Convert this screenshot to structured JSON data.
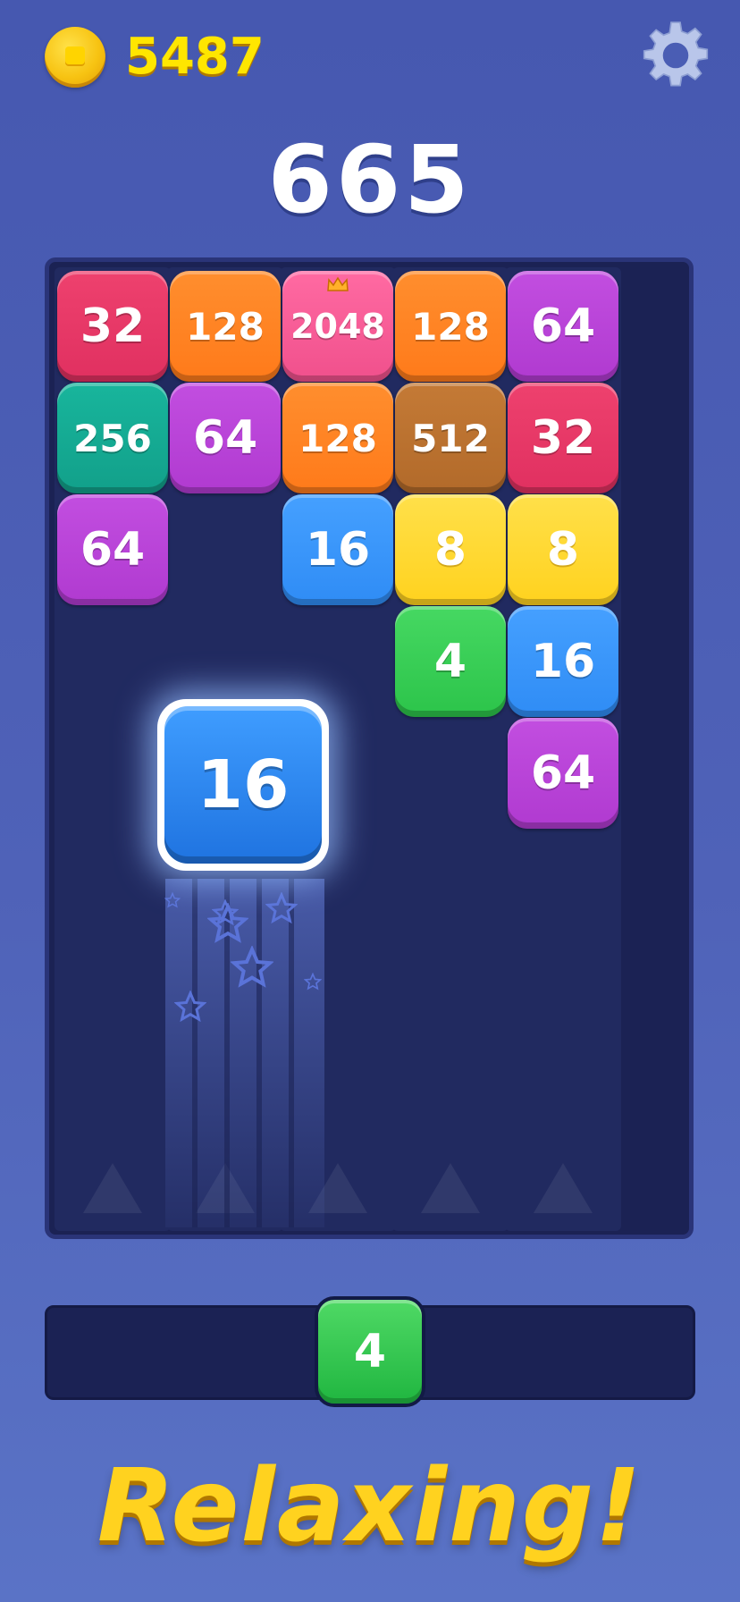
{
  "header": {
    "coins": "5487",
    "settings_icon": "gear-icon",
    "score": "665"
  },
  "colors": {
    "background": "#4f62b8",
    "board": "#1b2254",
    "tile_2048": "#f0508c",
    "tile_512": "#b26a2a",
    "tile_256": "#12a08a",
    "tile_128": "#ff7a1a",
    "tile_64": "#b03ad0",
    "tile_32": "#e03060",
    "tile_16": "#2f8cf5",
    "tile_8": "#ffd21e",
    "tile_4": "#2cc44a",
    "tagline": "#ffd21f"
  },
  "board": {
    "columns": 5,
    "rows": [
      [
        {
          "value": "32"
        },
        {
          "value": "128"
        },
        {
          "value": "2048",
          "crown": true
        },
        {
          "value": "128"
        },
        {
          "value": "64"
        }
      ],
      [
        {
          "value": "256"
        },
        {
          "value": "64"
        },
        {
          "value": "128"
        },
        {
          "value": "512"
        },
        {
          "value": "32"
        }
      ],
      [
        {
          "value": "64"
        },
        null,
        {
          "value": "16"
        },
        {
          "value": "8"
        },
        {
          "value": "8"
        }
      ],
      [
        null,
        null,
        null,
        {
          "value": "4"
        },
        {
          "value": "16"
        }
      ],
      [
        null,
        null,
        null,
        null,
        {
          "value": "64"
        }
      ]
    ]
  },
  "falling_tile": {
    "value": "16",
    "column": 2
  },
  "next_tile": {
    "value": "4"
  },
  "tagline": "Relaxing!"
}
